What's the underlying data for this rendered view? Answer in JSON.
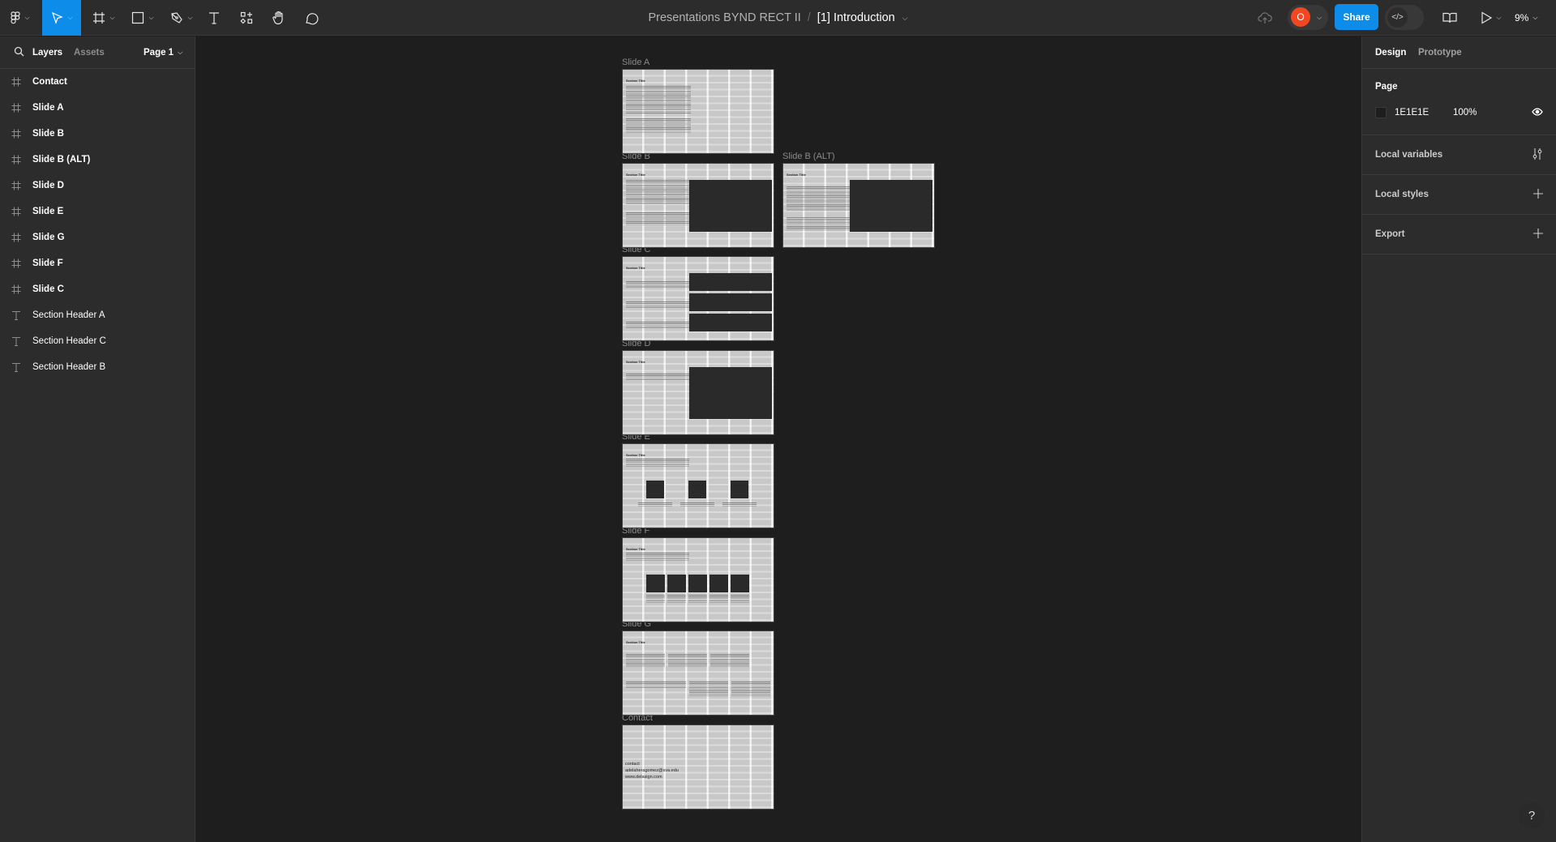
{
  "toolbar": {
    "tools": [
      {
        "name": "main-menu",
        "icon": "figma-logo-icon"
      },
      {
        "name": "move-tool",
        "icon": "cursor-icon",
        "active": true
      },
      {
        "name": "frame-tool",
        "icon": "frame-icon"
      },
      {
        "name": "shape-tool",
        "icon": "rectangle-icon"
      },
      {
        "name": "pen-tool",
        "icon": "pen-icon"
      },
      {
        "name": "text-tool",
        "icon": "text-icon"
      },
      {
        "name": "resources-tool",
        "icon": "resources-icon"
      },
      {
        "name": "hand-tool",
        "icon": "hand-icon"
      },
      {
        "name": "comment-tool",
        "icon": "comment-icon"
      }
    ],
    "project_name": "Presentations BYND RECT II",
    "separator": "/",
    "page_name": "[1] Introduction",
    "avatar_initial": "O",
    "share_label": "Share",
    "zoom_level": "9%"
  },
  "left_panel": {
    "tabs": [
      "Layers",
      "Assets"
    ],
    "active_tab": "Layers",
    "page_selector": "Page 1",
    "layers": [
      {
        "label": "Contact",
        "type": "frame"
      },
      {
        "label": "Slide A",
        "type": "frame"
      },
      {
        "label": "Slide B",
        "type": "frame"
      },
      {
        "label": "Slide B (ALT)",
        "type": "frame"
      },
      {
        "label": "Slide D",
        "type": "frame"
      },
      {
        "label": "Slide E",
        "type": "frame"
      },
      {
        "label": "Slide G",
        "type": "frame"
      },
      {
        "label": "Slide F",
        "type": "frame"
      },
      {
        "label": "Slide C",
        "type": "frame"
      },
      {
        "label": "Section Header A",
        "type": "text"
      },
      {
        "label": "Section Header C",
        "type": "text"
      },
      {
        "label": "Section Header B",
        "type": "text"
      }
    ]
  },
  "right_panel": {
    "tabs": [
      "Design",
      "Prototype"
    ],
    "active_tab": "Design",
    "page_section": {
      "title": "Page",
      "color_hex": "1E1E1E",
      "opacity": "100%"
    },
    "sections": [
      "Local variables",
      "Local styles",
      "Export"
    ]
  },
  "canvas": {
    "slides": [
      {
        "label": "Slide A",
        "section_title": "Section Title"
      },
      {
        "label": "Slide B",
        "section_title": "Section Title"
      },
      {
        "label": "Slide B (ALT)",
        "section_title": "Section Title"
      },
      {
        "label": "Slide C",
        "section_title": "Section Title"
      },
      {
        "label": "Slide D",
        "section_title": "Section Title"
      },
      {
        "label": "Slide E",
        "section_title": "Section Title"
      },
      {
        "label": "Slide F",
        "section_title": "Section Title"
      },
      {
        "label": "Slide G",
        "section_title": "Section Title"
      },
      {
        "label": "Contact",
        "section_title": ""
      }
    ],
    "contact_lines": [
      "contact",
      "adelaheragomez@sva.edu",
      "www.delasign.com"
    ]
  },
  "help_label": "?"
}
